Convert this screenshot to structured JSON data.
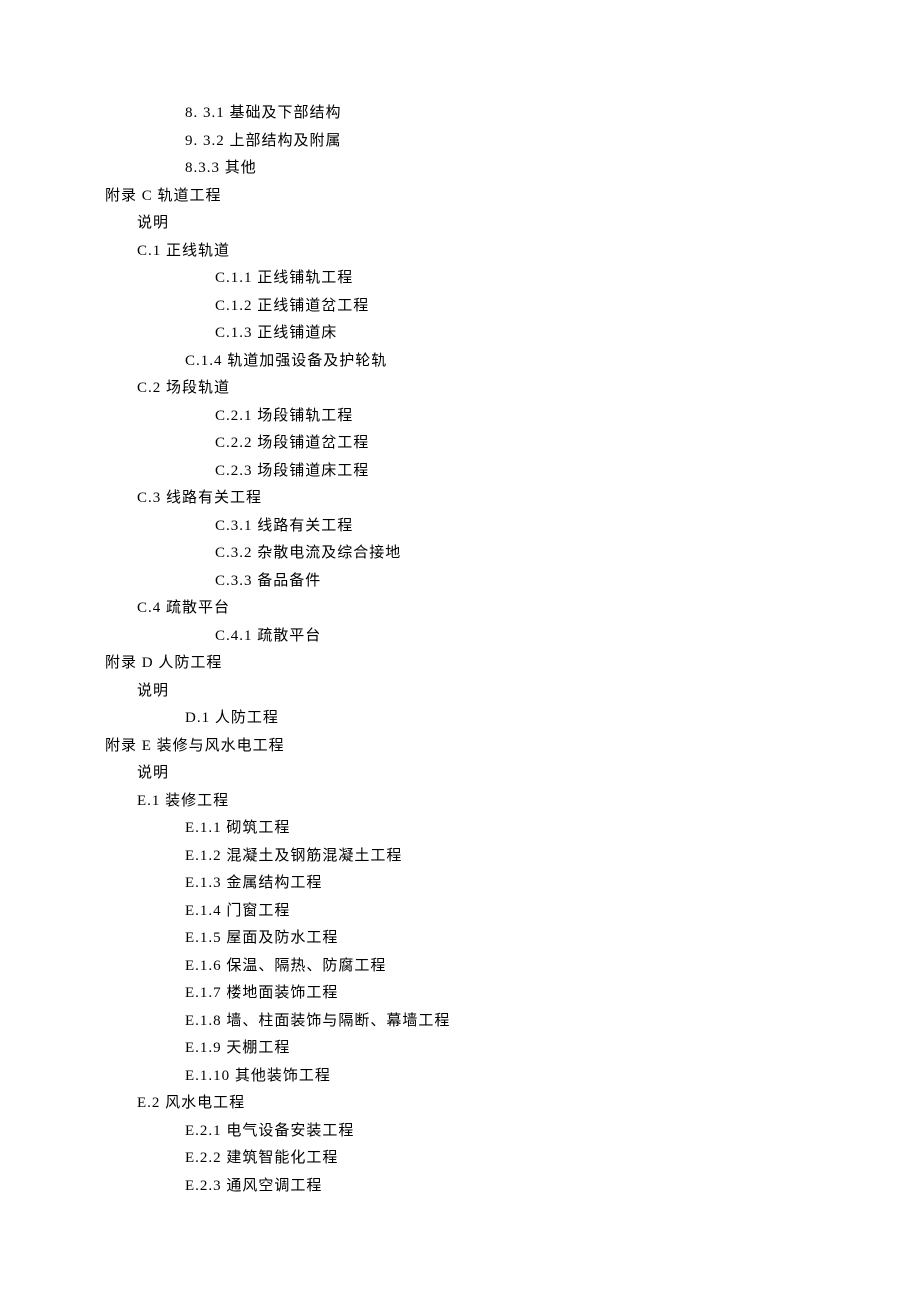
{
  "lines": [
    {
      "indent": "lvl2",
      "text": "8. 3.1 基础及下部结构"
    },
    {
      "indent": "lvl2",
      "text": "9. 3.2 上部结构及附属"
    },
    {
      "indent": "lvl2",
      "text": "8.3.3 其他"
    },
    {
      "indent": "lvl0",
      "text": "附录 C 轨道工程"
    },
    {
      "indent": "lvl1",
      "text": "说明"
    },
    {
      "indent": "lvl2b",
      "text": "C.1 正线轨道"
    },
    {
      "indent": "lvl3",
      "text": "C.1.1 正线铺轨工程"
    },
    {
      "indent": "lvl3",
      "text": "C.1.2 正线铺道岔工程"
    },
    {
      "indent": "lvl3",
      "text": "C.1.3 正线铺道床"
    },
    {
      "indent": "lvl2",
      "text": "C.1.4 轨道加强设备及护轮轨"
    },
    {
      "indent": "lvl2b",
      "text": "C.2 场段轨道"
    },
    {
      "indent": "lvl3",
      "text": "C.2.1 场段铺轨工程"
    },
    {
      "indent": "lvl3",
      "text": "C.2.2 场段铺道岔工程"
    },
    {
      "indent": "lvl3",
      "text": "C.2.3 场段铺道床工程"
    },
    {
      "indent": "lvl2b",
      "text": "C.3 线路有关工程"
    },
    {
      "indent": "lvl3",
      "text": "C.3.1 线路有关工程"
    },
    {
      "indent": "lvl3",
      "text": "C.3.2 杂散电流及综合接地"
    },
    {
      "indent": "lvl3",
      "text": "C.3.3 备品备件"
    },
    {
      "indent": "lvl2b",
      "text": "C.4 疏散平台"
    },
    {
      "indent": "lvl3",
      "text": "C.4.1 疏散平台"
    },
    {
      "indent": "lvl0",
      "text": "附录 D 人防工程"
    },
    {
      "indent": "lvl1",
      "text": "说明"
    },
    {
      "indent": "lvl2",
      "text": "D.1 人防工程"
    },
    {
      "indent": "lvl0",
      "text": "附录 E 装修与风水电工程"
    },
    {
      "indent": "lvl1",
      "text": "说明"
    },
    {
      "indent": "lvl2b",
      "text": "E.1 装修工程"
    },
    {
      "indent": "lvl2",
      "text": "E.1.1 砌筑工程"
    },
    {
      "indent": "lvl2",
      "text": "E.1.2 混凝土及钢筋混凝土工程"
    },
    {
      "indent": "lvl2",
      "text": "E.1.3 金属结构工程"
    },
    {
      "indent": "lvl2",
      "text": "E.1.4 门窗工程"
    },
    {
      "indent": "lvl2",
      "text": "E.1.5 屋面及防水工程"
    },
    {
      "indent": "lvl2",
      "text": "E.1.6 保温、隔热、防腐工程"
    },
    {
      "indent": "lvl2",
      "text": "E.1.7 楼地面装饰工程"
    },
    {
      "indent": "lvl2",
      "text": "E.1.8 墙、柱面装饰与隔断、幕墙工程"
    },
    {
      "indent": "lvl2",
      "text": "E.1.9 天棚工程"
    },
    {
      "indent": "lvl2",
      "text": "E.1.10 其他装饰工程"
    },
    {
      "indent": "lvl2b",
      "text": "E.2 风水电工程"
    },
    {
      "indent": "lvl2",
      "text": "E.2.1 电气设备安装工程"
    },
    {
      "indent": "lvl2",
      "text": "E.2.2 建筑智能化工程"
    },
    {
      "indent": "lvl2",
      "text": "E.2.3 通风空调工程"
    }
  ]
}
